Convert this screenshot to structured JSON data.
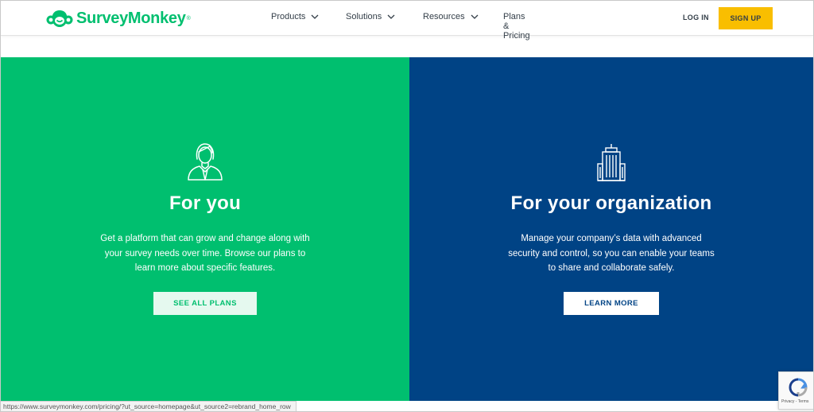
{
  "header": {
    "logo_text": "SurveyMonkey",
    "logo_mark": "®",
    "nav": [
      {
        "label": "Products",
        "dropdown": true
      },
      {
        "label": "Solutions",
        "dropdown": true
      },
      {
        "label": "Resources",
        "dropdown": true
      },
      {
        "label": "Plans & Pricing",
        "dropdown": false
      }
    ],
    "login_label": "LOG IN",
    "signup_label": "SIGN UP"
  },
  "panels": {
    "personal": {
      "icon": "person-icon",
      "title": "For you",
      "description": "Get a platform that can grow and change along with your survey needs over time. Browse our plans to learn more about specific features.",
      "button_label": "SEE ALL PLANS"
    },
    "organization": {
      "icon": "building-icon",
      "title": "For your organization",
      "description": "Manage your company’s data with advanced security and control, so you can enable your teams to share and collaborate safely.",
      "button_label": "LEARN MORE"
    }
  },
  "status_bar": {
    "url": "https://www.surveymonkey.com/pricing/?ut_source=homepage&ut_source2=rebrand_home_row"
  },
  "recaptcha": {
    "links": "Privacy - Terms"
  },
  "colors": {
    "brand_green": "#00bf6f",
    "navy": "#004385",
    "signup_yellow": "#f9be00",
    "nav_text": "#333e48"
  }
}
